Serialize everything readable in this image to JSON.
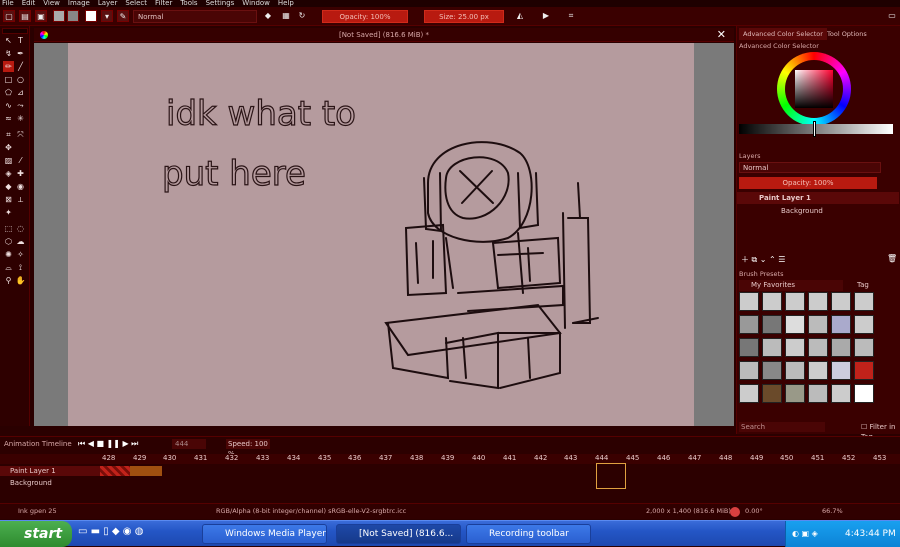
{
  "menu": [
    "File",
    "Edit",
    "View",
    "Image",
    "Layer",
    "Select",
    "Filter",
    "Tools",
    "Settings",
    "Window",
    "Help"
  ],
  "toolbar": {
    "blend_mode": "Normal",
    "opacity": "Opacity: 100%",
    "size": "Size: 25.00 px"
  },
  "document": {
    "tab_title": "[Not Saved]  (816.6 MiB) *",
    "handwriting_line1": "idk what to",
    "handwriting_line2": "put here"
  },
  "dock": {
    "tabs": [
      "Advanced Color Selector",
      "Tool Options"
    ],
    "color_selector_title": "Advanced Color Selector",
    "layers_title": "Layers",
    "layers_blend": "Normal",
    "layers_opacity": "Opacity: 100%",
    "layers": [
      {
        "name": "Paint Layer 1"
      },
      {
        "name": "Background"
      }
    ],
    "brush_presets_title": "Brush Presets",
    "brush_filter": "My Favorites",
    "tag_label": "Tag",
    "search_placeholder": "Search",
    "filter_in_tag": "Filter in Tag"
  },
  "timeline": {
    "title": "Animation Timeline",
    "frame_field": "444",
    "speed": "Speed: 100 %",
    "frames": [
      "428",
      "429",
      "430",
      "431",
      "432",
      "433",
      "434",
      "435",
      "436",
      "437",
      "438",
      "439",
      "440",
      "441",
      "442",
      "443",
      "444",
      "445",
      "446",
      "447",
      "448",
      "449",
      "450",
      "451",
      "452",
      "453"
    ],
    "layers": [
      "Paint Layer 1",
      "Background"
    ]
  },
  "status": {
    "brush": "Ink gpen 25",
    "color_model": "RGB/Alpha (8-bit integer/channel)  sRGB-elle-V2-srgbtrc.icc",
    "dimensions": "2,000 x 1,400 (816.6 MiB)",
    "rotation": "0.00°",
    "zoom": "66.7%"
  },
  "taskbar": {
    "start": "start",
    "tasks": [
      "Windows Media Player...",
      "[Not Saved]  (816.6...",
      "Recording toolbar"
    ],
    "clock": "4:43:44 PM"
  },
  "colors": {
    "accent_red": "#b81a10",
    "paper": "#b59b9e",
    "theme_dark": "#2a0000"
  }
}
